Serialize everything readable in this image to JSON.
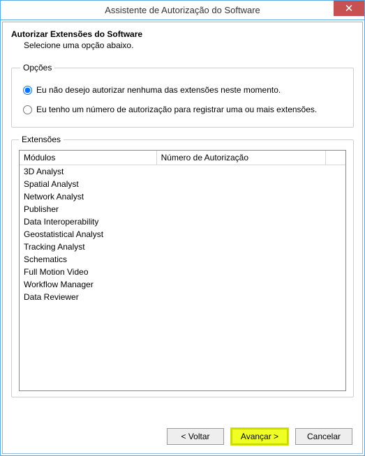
{
  "window": {
    "title": "Assistente de Autorização do Software"
  },
  "header": {
    "title": "Autorizar Extensões do Software",
    "subtitle": "Selecione uma opção abaixo."
  },
  "options": {
    "legend": "Opções",
    "radio1": "Eu não desejo autorizar nenhuma das extensões neste momento.",
    "radio2": "Eu tenho um número de autorização para registrar uma ou mais extensões.",
    "selected": 0
  },
  "extensions": {
    "legend": "Extensões",
    "columns": {
      "modules": "Módulos",
      "auth": "Número de Autorização"
    },
    "rows": [
      {
        "module": "3D Analyst",
        "auth": ""
      },
      {
        "module": "Spatial Analyst",
        "auth": ""
      },
      {
        "module": "Network Analyst",
        "auth": ""
      },
      {
        "module": "Publisher",
        "auth": ""
      },
      {
        "module": "Data Interoperability",
        "auth": ""
      },
      {
        "module": "Geostatistical Analyst",
        "auth": ""
      },
      {
        "module": "Tracking Analyst",
        "auth": ""
      },
      {
        "module": "Schematics",
        "auth": ""
      },
      {
        "module": "Full Motion Video",
        "auth": ""
      },
      {
        "module": "Workflow Manager",
        "auth": ""
      },
      {
        "module": "Data Reviewer",
        "auth": ""
      }
    ]
  },
  "buttons": {
    "back": "< Voltar",
    "next": "Avançar >",
    "cancel": "Cancelar"
  }
}
